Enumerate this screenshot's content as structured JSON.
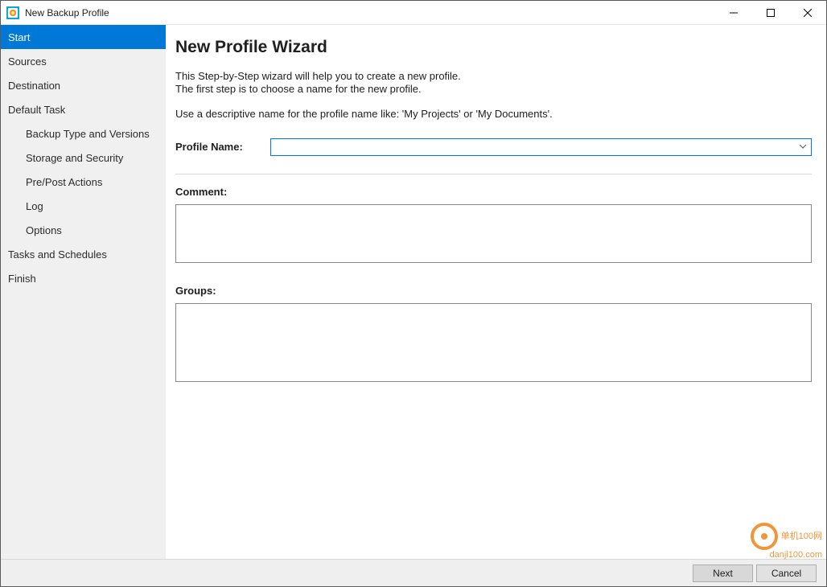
{
  "window": {
    "title": "New Backup Profile"
  },
  "sidebar": {
    "items": [
      {
        "label": "Start",
        "selected": true,
        "sub": false
      },
      {
        "label": "Sources",
        "selected": false,
        "sub": false
      },
      {
        "label": "Destination",
        "selected": false,
        "sub": false
      },
      {
        "label": "Default Task",
        "selected": false,
        "sub": false
      },
      {
        "label": "Backup Type and Versions",
        "selected": false,
        "sub": true
      },
      {
        "label": "Storage and Security",
        "selected": false,
        "sub": true
      },
      {
        "label": "Pre/Post Actions",
        "selected": false,
        "sub": true
      },
      {
        "label": "Log",
        "selected": false,
        "sub": true
      },
      {
        "label": "Options",
        "selected": false,
        "sub": true
      },
      {
        "label": "Tasks and Schedules",
        "selected": false,
        "sub": false
      },
      {
        "label": "Finish",
        "selected": false,
        "sub": false
      }
    ]
  },
  "main": {
    "heading": "New Profile Wizard",
    "desc1": "This Step-by-Step wizard will help you to create a new profile.",
    "desc2": "The first step is to choose a name  for the new profile.",
    "desc3": "Use a descriptive name for the profile name like: 'My Projects' or 'My Documents'.",
    "profile_name_label": "Profile Name:",
    "profile_name_value": "",
    "comment_label": "Comment:",
    "comment_value": "",
    "groups_label": "Groups:"
  },
  "footer": {
    "next": "Next",
    "cancel": "Cancel"
  },
  "watermark": {
    "line1": "单机100网",
    "line2": "danji100.com"
  }
}
